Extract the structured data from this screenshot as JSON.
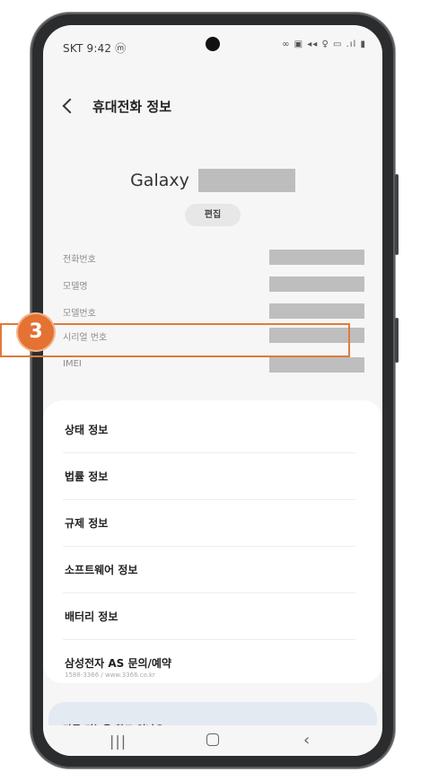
{
  "status": {
    "carrier_time": "SKT 9:42",
    "left_icon": "ⓜ",
    "right_icons": "∞ ▣ ◂◂ ♀ ▭ .ıl ▮"
  },
  "header": {
    "title": "휴대전화 정보"
  },
  "device": {
    "name": "Galaxy",
    "edit_label": "편집"
  },
  "info_rows": [
    {
      "label": "전화번호"
    },
    {
      "label": "모델명"
    },
    {
      "label": "모델번호"
    },
    {
      "label": "시리얼 번호"
    },
    {
      "label": "IMEI"
    }
  ],
  "step": {
    "number": "3"
  },
  "menu": [
    {
      "label": "상태 정보"
    },
    {
      "label": "법률 정보"
    },
    {
      "label": "규제 정보"
    },
    {
      "label": "소프트웨어 정보"
    },
    {
      "label": "배터리 정보"
    },
    {
      "label": "삼성전자 AS 문의/예약",
      "sub": "1588-3366 / www.3366.co.kr"
    }
  ],
  "suggestion": {
    "text": "다른 기능을 찾고 있나요?"
  },
  "navbar": {
    "recents": "|||",
    "back": "‹"
  },
  "colors": {
    "highlight": "#e07a3c",
    "badge": "#e47232"
  }
}
